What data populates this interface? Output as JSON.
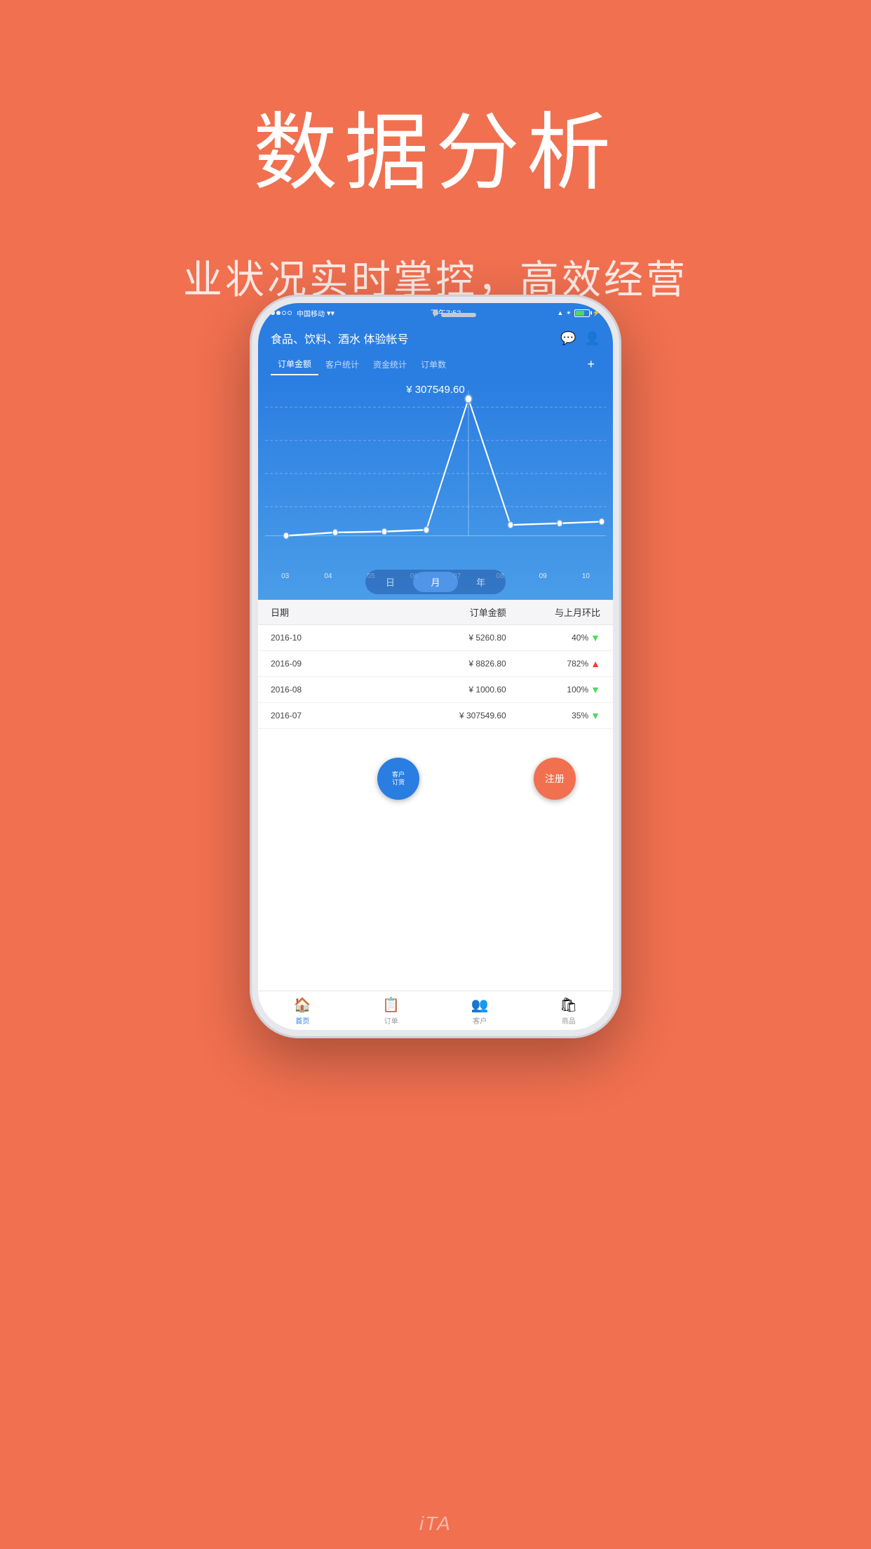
{
  "hero": {
    "title": "数据分析",
    "subtitle": "业状况实时掌控，高效经营"
  },
  "status_bar": {
    "carrier": "中国移动",
    "time": "下午7:52",
    "wifi": "📶"
  },
  "app_header": {
    "title": "食品、饮料、酒水 体验帐号",
    "tabs": [
      "订单金额",
      "客户统计",
      "资金统计",
      "订单数"
    ],
    "plus_label": "+"
  },
  "chart": {
    "value_label": "¥ 307549.60",
    "x_labels": [
      "03",
      "04",
      "05",
      "06",
      "07",
      "08",
      "09",
      "10"
    ],
    "period_buttons": [
      "日",
      "月",
      "年"
    ],
    "active_period": 1
  },
  "table": {
    "headers": [
      "日期",
      "订单金额",
      "与上月环比"
    ],
    "rows": [
      {
        "date": "2016-10",
        "amount": "¥ 5260.80",
        "change": "40%",
        "direction": "down"
      },
      {
        "date": "2016-09",
        "amount": "¥ 8826.80",
        "change": "782%",
        "direction": "up"
      },
      {
        "date": "2016-08",
        "amount": "¥ 1000.60",
        "change": "100%",
        "direction": "down"
      },
      {
        "date": "2016-07",
        "amount": "¥ 307549.60",
        "change": "35%",
        "direction": "down"
      }
    ]
  },
  "bottom_nav": {
    "items": [
      "首页",
      "订单",
      "客户",
      "商品"
    ],
    "active_index": 0
  },
  "float_buttons": {
    "customer": "客户\n订货",
    "register": "注册"
  },
  "watermark": "iTA"
}
